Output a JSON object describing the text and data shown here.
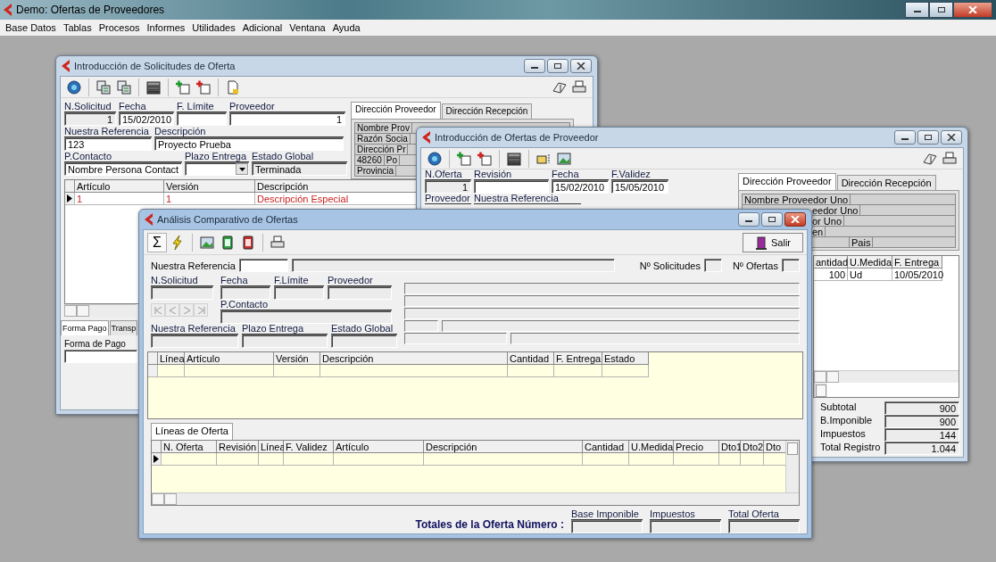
{
  "app_title": "Demo: Ofertas de Proveedores",
  "menu": [
    "Base Datos",
    "Tablas",
    "Procesos",
    "Informes",
    "Utilidades",
    "Adicional",
    "Ventana",
    "Ayuda"
  ],
  "solicitudes": {
    "title": "Introducción de Solicitudes de Oferta",
    "active": false,
    "fields": [
      {
        "kind": "text",
        "label": "N.Solicitud",
        "value": "1"
      },
      {
        "kind": "text",
        "label": "Fecha",
        "value": "15/02/2010"
      },
      {
        "kind": "text",
        "label": "F. Límite"
      },
      {
        "kind": "text",
        "label": "Proveedor",
        "value": "1"
      },
      {
        "kind": "text",
        "label": "Nuestra Referencia",
        "value": "123"
      },
      {
        "kind": "text",
        "label": "Descripción",
        "value": "Proyecto Prueba"
      },
      {
        "kind": "text",
        "label": "P.Contacto",
        "value": "Nombre Persona Contact"
      },
      {
        "kind": "dropdown",
        "label": "Plazo Entrega"
      },
      {
        "kind": "text",
        "label": "Estado Global",
        "value": "Terminada"
      }
    ],
    "address_tabs": [
      {
        "label": "Dirección Proveedor",
        "selected": true
      },
      {
        "label": "Dirección Recepción",
        "selected": false
      }
    ],
    "address_rows": [
      [
        "Nombre Prov"
      ],
      [
        "Razón Socia"
      ],
      [
        "Dirección Pr"
      ],
      [
        "48260",
        "Po"
      ],
      [
        "Provincia"
      ]
    ],
    "grid": {
      "columns": [
        "Artículo",
        "Versión",
        "Descripción"
      ],
      "rows": [
        {
          "selected": true,
          "cells": [
            "1",
            "1",
            "Descripción Especial"
          ]
        }
      ]
    },
    "bottom_tabs": [
      {
        "label": "Forma Pago",
        "selected": true
      },
      {
        "label": "Transp",
        "selected": false
      }
    ],
    "payment_label": "Forma de Pago"
  },
  "ofertas": {
    "title": "Introducción de Ofertas de Proveedor",
    "active": false,
    "fields": [
      {
        "label": "N.Oferta",
        "value": "1"
      },
      {
        "label": "Revisión"
      },
      {
        "label": "Fecha",
        "value": "15/02/2010"
      },
      {
        "label": "F.Validez",
        "value": "15/05/2010"
      }
    ],
    "second_row_labels": [
      "Proveedor",
      "Nuestra Referencia"
    ],
    "address_tabs": [
      {
        "label": "Dirección Proveedor",
        "selected": true
      },
      {
        "label": "Dirección Recepción",
        "selected": false
      }
    ],
    "address_rows": [
      [
        "Nombre Proveedor Uno"
      ],
      [
        "eedor Uno"
      ],
      [
        "or Uno"
      ],
      [
        "en"
      ],
      [
        "Pais"
      ]
    ],
    "grid": {
      "columns": [
        "antidad",
        "U.Medida",
        "F. Entrega"
      ],
      "rows": [
        {
          "cells": [
            "100",
            "Ud",
            "10/05/2010"
          ]
        }
      ]
    },
    "totals": [
      {
        "label": "Subtotal",
        "value": "900"
      },
      {
        "label": "B.Imponible",
        "value": "900"
      },
      {
        "label": "Impuestos",
        "value": "144"
      },
      {
        "label": "Total Registro",
        "value": "1.044"
      }
    ]
  },
  "analisis": {
    "title": "Análisis Comparativo de Ofertas",
    "active": true,
    "sigma": "Σ",
    "exit_button": "Salir",
    "ref_label": "Nuestra Referencia",
    "solicitudes_label": "Nº Solicitudes",
    "ofertas_label": "Nº Ofertas",
    "fields": [
      {
        "label": "N.Solicitud"
      },
      {
        "label": "Fecha"
      },
      {
        "label": "F.Límite"
      },
      {
        "label": "Proveedor"
      },
      {
        "label": "P.Contacto"
      },
      {
        "label": "Nuestra Referencia"
      },
      {
        "label": "Plazo Entrega"
      },
      {
        "label": "Estado Global"
      }
    ],
    "nav_disabled": true,
    "grid1": {
      "columns": [
        "Línea",
        "Artículo",
        "Versión",
        "Descripción",
        "Cantidad",
        "F. Entrega",
        "Estado"
      ],
      "rows": [
        {
          "selected": false
        }
      ]
    },
    "tabs": [
      {
        "label": "Líneas de Oferta",
        "selected": true
      }
    ],
    "grid2": {
      "columns": [
        "N. Oferta",
        "Revisión",
        "Línea",
        "F. Validez",
        "Artículo",
        "Descripción",
        "Cantidad",
        "U.Medida",
        "Precio",
        "Dto1",
        "Dto2",
        "Dto"
      ],
      "rows": [
        {
          "selected": true
        }
      ]
    },
    "totals_label": "Totales de la Oferta Número :",
    "totals": [
      "Base Imponible",
      "Impuestos",
      "Total Oferta"
    ]
  }
}
